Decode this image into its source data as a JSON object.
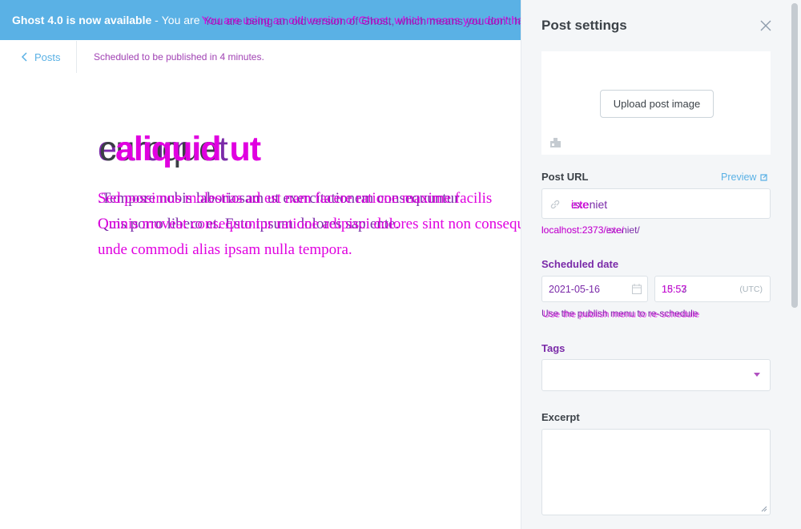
{
  "banner": {
    "headline": "Ghost 4.0 is now available",
    "separator": " - ",
    "message_a": "You are using an old version of Ghost, which means you don't have",
    "message_b": "You are being an old version of Ghost, which means you don't have",
    "message_c": "You are"
  },
  "topbar": {
    "back_label": "Posts",
    "status_a": "Scheduled to be published in 4 minutes.",
    "status_b": "Scheduled to be published in 4 minutes."
  },
  "editor": {
    "title_a": "earum et",
    "title_b": "cumque",
    "title_c": "aliquid ut",
    "body_line1_a": ".Tempore nobis laboriosam ut exercitationem consequuntur",
    "body_line1_b": "Sed possimus molestias ad est nam facere ratione maxime facilis",
    "body_line2_a": "Quis porro libero et. Esto ipsum dolores sapiente.",
    "body_line2_b": "Omnis moveat consequuntur ratione adipisci dolores sint non consequuntur",
    "body_line3": "unde commodi alias ipsam nulla tempora."
  },
  "panel": {
    "title": "Post settings",
    "upload_label": "Upload post image",
    "post_url_label": "Post URL",
    "preview_label": "Preview",
    "url_value_a": "exeniet",
    "url_value_b": "iste",
    "url_hint_a": "localhost:2373/exeniet/",
    "url_hint_b": "localhost:2373/iste/",
    "scheduled_label": "Scheduled date",
    "date_value": "2021-05-16",
    "time_value_a": "15:53",
    "time_value_b": "18:57",
    "timezone": "(UTC)",
    "schedule_hint_a": "Use the publish menu to re-schedule",
    "schedule_hint_b": "Use the publish menu to re-schedule",
    "tags_label": "Tags",
    "excerpt_label": "Excerpt",
    "excerpt_value": ""
  },
  "colors": {
    "accent": "#5ab1e5",
    "overlay_magenta": "#e000e0",
    "overlay_purple": "#7a2aa8"
  }
}
